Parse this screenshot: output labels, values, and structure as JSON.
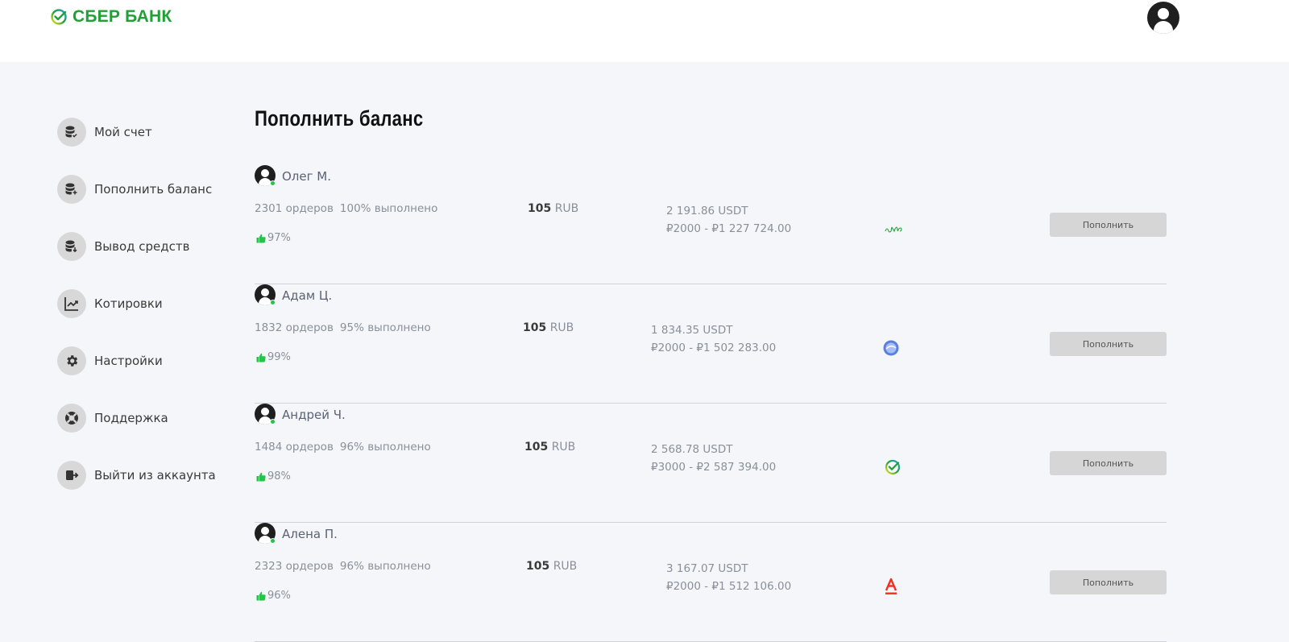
{
  "header": {
    "logo_text": "СБЕР БАНК"
  },
  "sidebar": {
    "items": [
      {
        "label": "Мой счет",
        "icon": "coins-check-icon"
      },
      {
        "label": "Пополнить баланс",
        "icon": "coins-plus-icon"
      },
      {
        "label": "Вывод средств",
        "icon": "coins-down-icon"
      },
      {
        "label": "Котировки",
        "icon": "chart-icon"
      },
      {
        "label": "Настройки",
        "icon": "gear-icon"
      },
      {
        "label": "Поддержка",
        "icon": "lifebuoy-icon"
      },
      {
        "label": "Выйти из аккаунта",
        "icon": "logout-icon"
      }
    ]
  },
  "main": {
    "title": "Пополнить баланс",
    "offers": [
      {
        "name": "Олег М.",
        "orders": "2301 ордеров",
        "completed": "100% выполнено",
        "rating": "97%",
        "price_value": "105",
        "price_currency": "RUB",
        "usdt": "2 191.86 USDT",
        "limits": "₽2000 - ₽1 227 724.00",
        "bank_icon": "tinkoff-icon",
        "button": "Пополнить"
      },
      {
        "name": "Адам Ц.",
        "orders": "1832 ордеров",
        "completed": "95% выполнено",
        "rating": "99%",
        "price_value": "105",
        "price_currency": "RUB",
        "usdt": "1 834.35 USDT",
        "limits": "₽2000 - ₽1 502 283.00",
        "bank_icon": "vtb-icon",
        "button": "Пополнить"
      },
      {
        "name": "Андрей Ч.",
        "orders": "1484 ордеров",
        "completed": "96% выполнено",
        "rating": "98%",
        "price_value": "105",
        "price_currency": "RUB",
        "usdt": "2 568.78 USDT",
        "limits": "₽3000 - ₽2 587 394.00",
        "bank_icon": "sber-icon",
        "button": "Пополнить"
      },
      {
        "name": "Алена П.",
        "orders": "2323 ордеров",
        "completed": "96% выполнено",
        "rating": "96%",
        "price_value": "105",
        "price_currency": "RUB",
        "usdt": "3 167.07 USDT",
        "limits": "₽2000 - ₽1 512 106.00",
        "bank_icon": "alfa-icon",
        "button": "Пополнить"
      }
    ]
  },
  "colors": {
    "brand": "#21a038",
    "background": "#f4f6f9",
    "online": "#27c24c",
    "button": "#d6d6d6"
  }
}
